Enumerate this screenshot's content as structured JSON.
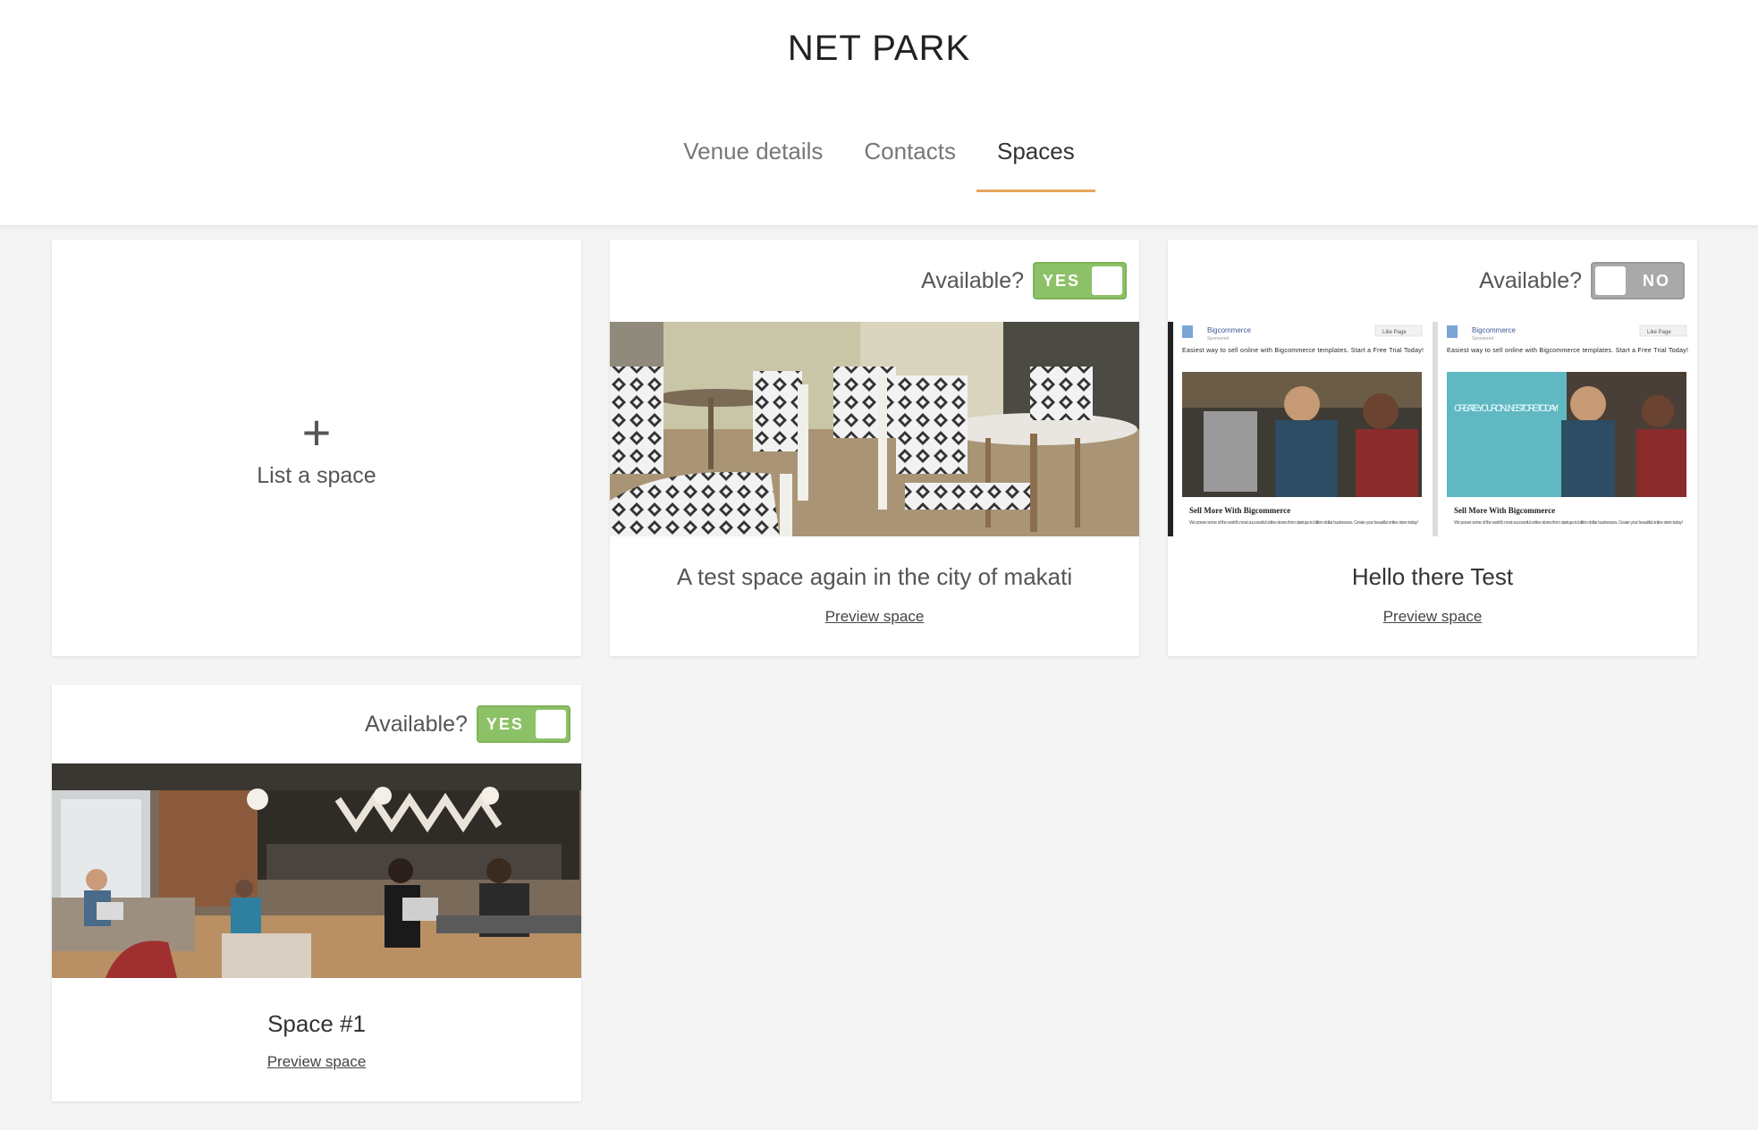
{
  "venue": {
    "title": "NET PARK"
  },
  "tabs": [
    {
      "label": "Venue details"
    },
    {
      "label": "Contacts"
    },
    {
      "label": "Spaces"
    }
  ],
  "list_space": {
    "label": "List a space"
  },
  "spaces": [
    {
      "available_label": "Available?",
      "available": true,
      "toggle_text": "YES",
      "title": "A test space again in the city of makati",
      "preview_label": "Preview space"
    },
    {
      "available_label": "Available?",
      "available": false,
      "toggle_text": "NO",
      "title": "Hello there Test",
      "preview_label": "Preview space",
      "ad": {
        "brand": "Bigcommerce",
        "sponsored": "Sponsored",
        "like": "Like Page",
        "copy": "Easiest way to sell online with Bigcommerce templates. Start a Free Trial Today!",
        "headline": "Sell More With Bigcommerce",
        "body": "We power some of the world's most successful online stores from startups to billion-dollar businesses. Create your beautiful online store today!",
        "banner": "CREATE YOUR ONLINE STORE TODAY!"
      }
    },
    {
      "available_label": "Available?",
      "available": true,
      "toggle_text": "YES",
      "title": "Space #1",
      "preview_label": "Preview space"
    }
  ],
  "colors": {
    "tab_underline": "#e6a65d",
    "toggle_on": "#8dc167",
    "toggle_off": "#a9a9a9",
    "background": "#f4f4f4"
  }
}
